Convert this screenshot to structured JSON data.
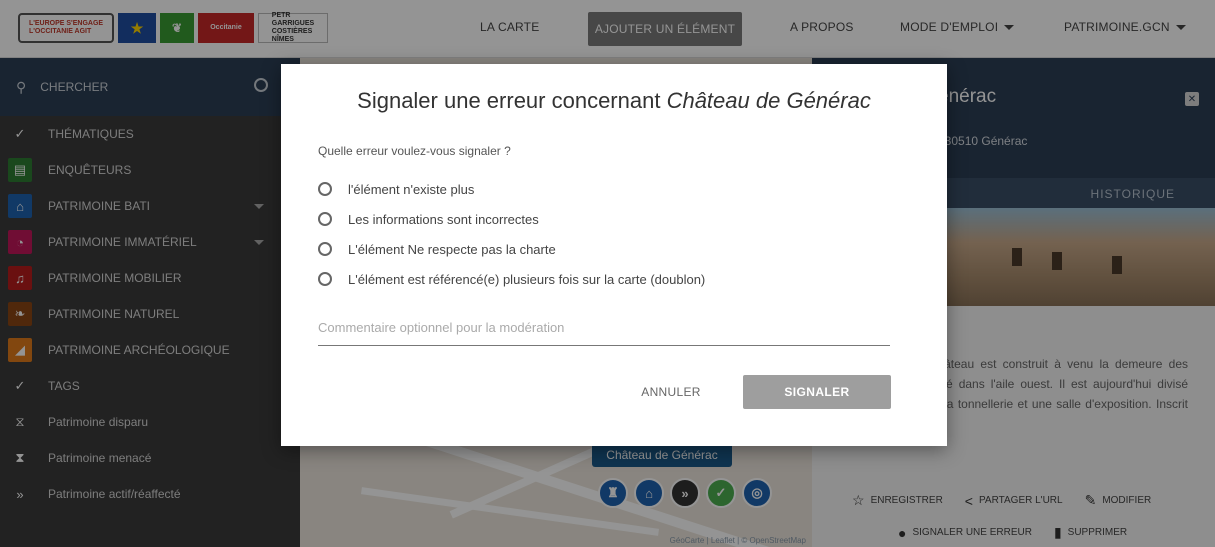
{
  "topbar": {
    "logos": {
      "europe_line1": "L'EUROPE S'ENGAGE",
      "europe_line2": "L'OCCITANIE AGIT",
      "occitanie": "Occitanie",
      "nimes_line1": "PETR",
      "nimes_line2": "GARRIGUES",
      "nimes_line3": "COSTIÈRES",
      "nimes_line4": "NÎMES"
    },
    "nav": {
      "carte": "LA CARTE",
      "ajouter": "AJOUTER UN ÉLÉMENT",
      "apropos": "A PROPOS",
      "mode": "MODE D'EMPLOI",
      "user": "PATRIMOINE.GCN"
    }
  },
  "sidebar": {
    "search_placeholder": "CHERCHER",
    "items": [
      {
        "label": "THÉMATIQUES",
        "icon": "check-icon",
        "color": "#3b3b3b",
        "glyph": "✓"
      },
      {
        "label": "ENQUÊTEURS",
        "icon": "id-card-icon",
        "color": "#2e7d32",
        "glyph": "▤"
      },
      {
        "label": "PATRIMOINE BATI",
        "icon": "roof-icon",
        "color": "#1e63b0",
        "glyph": "⌂",
        "dropdown": true
      },
      {
        "label": "PATRIMOINE IMMATÉRIEL",
        "icon": "mask-icon",
        "color": "#c2185b",
        "glyph": "◔",
        "dropdown": true
      },
      {
        "label": "PATRIMOINE MOBILIER",
        "icon": "bell-icon",
        "color": "#b71c1c",
        "glyph": "♫"
      },
      {
        "label": "PATRIMOINE NATUREL",
        "icon": "leaf-icon",
        "color": "#8b4513",
        "glyph": "❧"
      },
      {
        "label": "PATRIMOINE ARCHÉOLOGIQUE",
        "icon": "trowel-icon",
        "color": "#e07b1a",
        "glyph": "◢"
      },
      {
        "label": "TAGS",
        "icon": "check-icon",
        "color": "#3b3b3b",
        "glyph": "✓"
      },
      {
        "label": "Patrimoine disparu",
        "icon": "hourglass-empty-icon",
        "color": "#3b3b3b",
        "glyph": "⧖"
      },
      {
        "label": "Patrimoine menacé",
        "icon": "hourglass-icon",
        "color": "#3b3b3b",
        "glyph": "⧗"
      },
      {
        "label": "Patrimoine actif/réaffecté",
        "icon": "double-chevron-icon",
        "color": "#3b3b3b",
        "glyph": "»"
      }
    ]
  },
  "map": {
    "marker_label": "Château de Générac",
    "attribution": "GéoCarte | Leaflet | © OpenStreetMap"
  },
  "panel": {
    "title": "énérac",
    "address": ", 30510 Générac",
    "tab_historique": "HISTORIQUE",
    "description": "t Saint-Gilles, ce château est construit à venu la demeure des protestants au 17e, é dans l'aile ouest. Il est aujourd'hui divisé mairie, le musée de la tonnellerie et une salle d'exposition. Inscrit MH en 1993.",
    "actions": {
      "enregistrer": "ENREGISTRER",
      "partager": "PARTAGER L'URL",
      "modifier": "MODIFIER",
      "signaler": "SIGNALER UNE ERREUR",
      "supprimer": "SUPPRIMER"
    }
  },
  "modal": {
    "title_prefix": "Signaler une erreur concernant ",
    "title_item": "Château de Générac",
    "question": "Quelle erreur voulez-vous signaler ?",
    "options": [
      "l'élément n'existe plus",
      "Les informations sont incorrectes",
      "L'élément Ne respecte pas la charte",
      "L'élément est référencé(e) plusieurs fois sur la carte (doublon)"
    ],
    "comment_placeholder": "Commentaire optionnel pour la modération",
    "cancel_label": "ANNULER",
    "submit_label": "SIGNALER"
  }
}
